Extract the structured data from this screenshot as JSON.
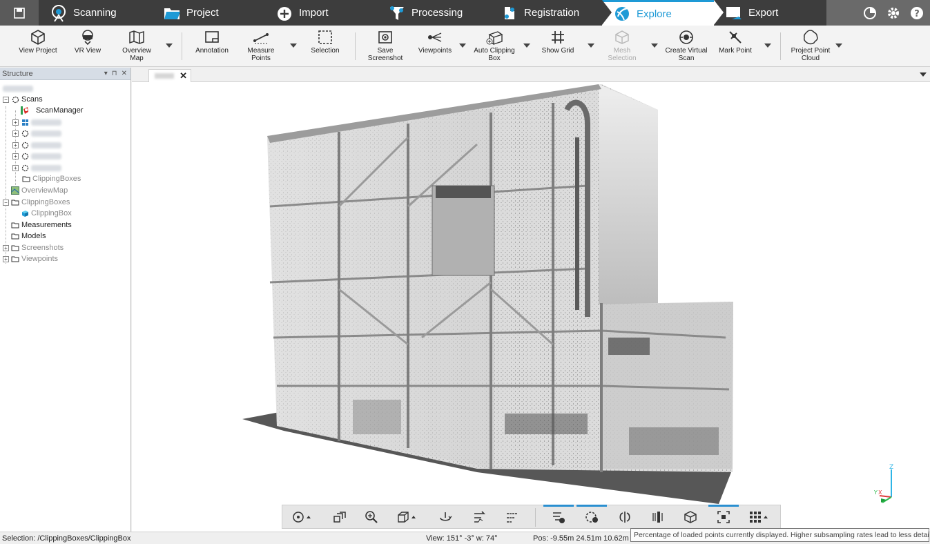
{
  "workflow_tabs": [
    {
      "label": "Scanning",
      "icon": "scanner-icon"
    },
    {
      "label": "Project",
      "icon": "folder-icon"
    },
    {
      "label": "Import",
      "icon": "import-icon"
    },
    {
      "label": "Processing",
      "icon": "processing-icon"
    },
    {
      "label": "Registration",
      "icon": "registration-icon"
    },
    {
      "label": "Explore",
      "icon": "explore-icon",
      "active": true
    },
    {
      "label": "Export",
      "icon": "export-icon"
    }
  ],
  "ribbon": {
    "view_project": "View Project",
    "vr_view": "VR View",
    "overview_map_1": "Overview",
    "overview_map_2": "Map",
    "annotation": "Annotation",
    "measure_points_1": "Measure",
    "measure_points_2": "Points",
    "selection": "Selection",
    "save_screenshot_1": "Save",
    "save_screenshot_2": "Screenshot",
    "viewpoints": "Viewpoints",
    "auto_clipping_1": "Auto Clipping",
    "auto_clipping_2": "Box",
    "show_grid": "Show Grid",
    "mesh_selection_1": "Mesh",
    "mesh_selection_2": "Selection",
    "create_virtual_scan_1": "Create Virtual",
    "create_virtual_scan_2": "Scan",
    "mark_point": "Mark Point",
    "project_point_cloud_1": "Project Point",
    "project_point_cloud_2": "Cloud"
  },
  "structure": {
    "title": "Structure",
    "items": {
      "scans": "Scans",
      "scan_manager": "ScanManager",
      "clipping_boxes_inner": "ClippingBoxes",
      "overview_map": "OverviewMap",
      "clipping_boxes": "ClippingBoxes",
      "clipping_box": "ClippingBox",
      "measurements": "Measurements",
      "models": "Models",
      "screenshots": "Screenshots",
      "viewpoints": "Viewpoints"
    }
  },
  "axes": {
    "z": "Z",
    "y": "Y",
    "x": "X"
  },
  "status": {
    "selection": "Selection: /ClippingBoxes/ClippingBox",
    "view": "View: 151° -3° w: 74°",
    "pos": "Pos: -9.55m 24.51m 10.62m",
    "tooltip": "Percentage of loaded points currently displayed. Higher subsampling rates lead to less detail."
  },
  "colors": {
    "accent": "#1e9ad6",
    "topbar": "#4b4b4b"
  }
}
